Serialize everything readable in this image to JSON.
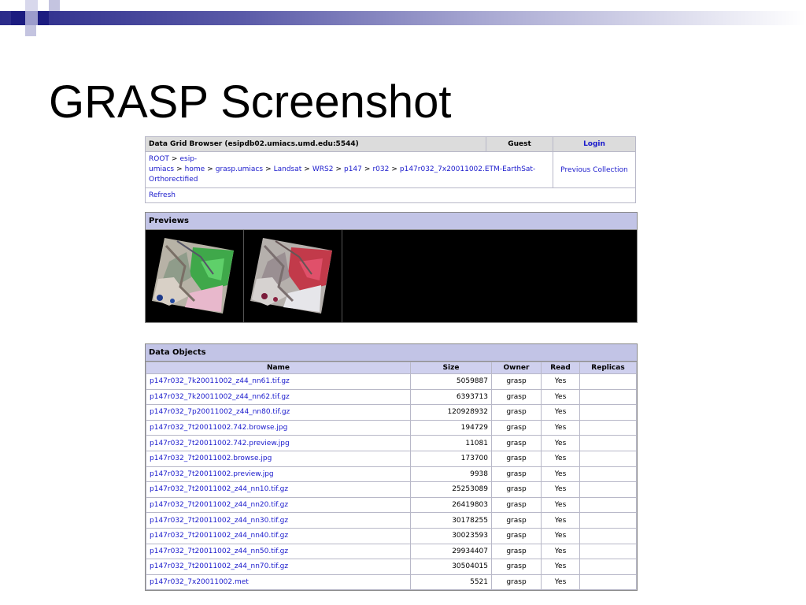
{
  "slide": {
    "title": "GRASP Screenshot"
  },
  "browser": {
    "header": "Data Grid Browser (esipdb02.umiacs.umd.edu:5544)",
    "user": "Guest",
    "login": "Login",
    "breadcrumb": [
      "ROOT",
      "esip-umiacs",
      "home",
      "grasp.umiacs",
      "Landsat",
      "WRS2",
      "p147",
      "r032",
      "p147r032_7x20011002.ETM-EarthSat-Orthorectified"
    ],
    "separator": ">",
    "previous_collection": "Previous Collection",
    "refresh": "Refresh"
  },
  "previews": {
    "heading": "Previews",
    "images": [
      {
        "name": "preview-742-thumbnail",
        "palette": "green"
      },
      {
        "name": "preview-thumbnail",
        "palette": "red"
      }
    ]
  },
  "data_objects": {
    "heading": "Data Objects",
    "columns": [
      "Name",
      "Size",
      "Owner",
      "Read",
      "Replicas"
    ],
    "rows": [
      {
        "name": "p147r032_7k20011002_z44_nn61.tif.gz",
        "size": "5059887",
        "owner": "grasp",
        "read": "Yes",
        "replicas": ""
      },
      {
        "name": "p147r032_7k20011002_z44_nn62.tif.gz",
        "size": "6393713",
        "owner": "grasp",
        "read": "Yes",
        "replicas": ""
      },
      {
        "name": "p147r032_7p20011002_z44_nn80.tif.gz",
        "size": "120928932",
        "owner": "grasp",
        "read": "Yes",
        "replicas": ""
      },
      {
        "name": "p147r032_7t20011002.742.browse.jpg",
        "size": "194729",
        "owner": "grasp",
        "read": "Yes",
        "replicas": ""
      },
      {
        "name": "p147r032_7t20011002.742.preview.jpg",
        "size": "11081",
        "owner": "grasp",
        "read": "Yes",
        "replicas": ""
      },
      {
        "name": "p147r032_7t20011002.browse.jpg",
        "size": "173700",
        "owner": "grasp",
        "read": "Yes",
        "replicas": ""
      },
      {
        "name": "p147r032_7t20011002.preview.jpg",
        "size": "9938",
        "owner": "grasp",
        "read": "Yes",
        "replicas": ""
      },
      {
        "name": "p147r032_7t20011002_z44_nn10.tif.gz",
        "size": "25253089",
        "owner": "grasp",
        "read": "Yes",
        "replicas": ""
      },
      {
        "name": "p147r032_7t20011002_z44_nn20.tif.gz",
        "size": "26419803",
        "owner": "grasp",
        "read": "Yes",
        "replicas": ""
      },
      {
        "name": "p147r032_7t20011002_z44_nn30.tif.gz",
        "size": "30178255",
        "owner": "grasp",
        "read": "Yes",
        "replicas": ""
      },
      {
        "name": "p147r032_7t20011002_z44_nn40.tif.gz",
        "size": "30023593",
        "owner": "grasp",
        "read": "Yes",
        "replicas": ""
      },
      {
        "name": "p147r032_7t20011002_z44_nn50.tif.gz",
        "size": "29934407",
        "owner": "grasp",
        "read": "Yes",
        "replicas": ""
      },
      {
        "name": "p147r032_7t20011002_z44_nn70.tif.gz",
        "size": "30504015",
        "owner": "grasp",
        "read": "Yes",
        "replicas": ""
      },
      {
        "name": "p147r032_7x20011002.met",
        "size": "5521",
        "owner": "grasp",
        "read": "Yes",
        "replicas": ""
      }
    ]
  },
  "colors": {
    "link": "#1a1acc",
    "section_header": "#c2c4e6",
    "column_header": "#cfd0ee",
    "slide_bar": "#2b2b8a"
  }
}
